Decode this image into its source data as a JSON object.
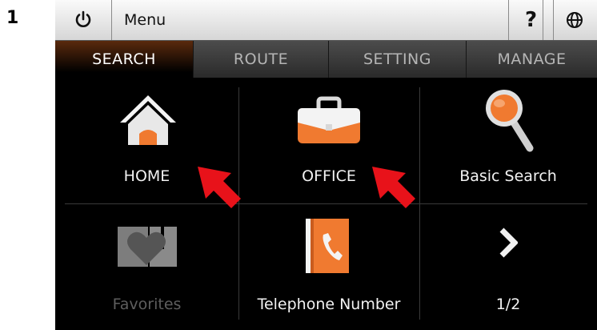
{
  "step_number": "1",
  "topbar": {
    "menu_label": "Menu",
    "help_label": "?"
  },
  "tabs": [
    {
      "label": "SEARCH",
      "active": true
    },
    {
      "label": "ROUTE",
      "active": false
    },
    {
      "label": "SETTING",
      "active": false
    },
    {
      "label": "MANAGE",
      "active": false
    }
  ],
  "grid": {
    "items": [
      {
        "label": "HOME",
        "icon": "home-icon"
      },
      {
        "label": "OFFICE",
        "icon": "briefcase-icon"
      },
      {
        "label": "Basic Search",
        "icon": "magnifier-icon"
      },
      {
        "label": "Favorites",
        "icon": "favorites-heart-icon",
        "disabled": true
      },
      {
        "label": "Telephone Number",
        "icon": "phone-book-icon"
      },
      {
        "label": "1/2",
        "icon": "chevron-right-icon"
      }
    ]
  },
  "colors": {
    "accent_orange": "#f07a30",
    "arrow_red": "#e8121a",
    "active_tab": "#5a2a0d"
  }
}
